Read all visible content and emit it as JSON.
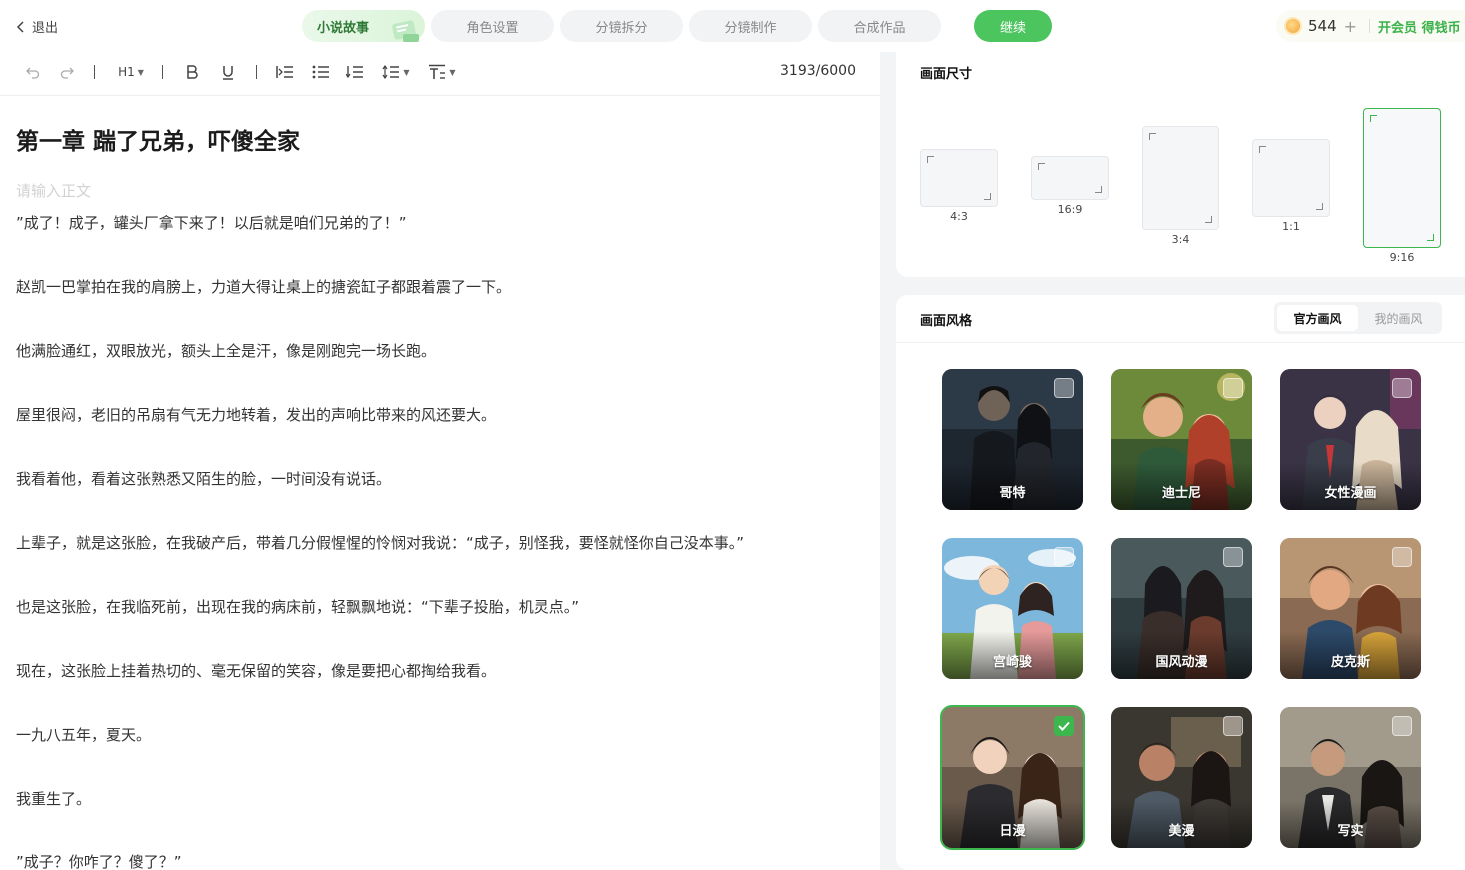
{
  "header": {
    "exit_label": "退出",
    "steps": [
      {
        "label": "小说故事",
        "active": true
      },
      {
        "label": "角色设置",
        "active": false
      },
      {
        "label": "分镜拆分",
        "active": false
      },
      {
        "label": "分镜制作",
        "active": false
      },
      {
        "label": "合成作品",
        "active": false
      }
    ],
    "continue_label": "继续",
    "coins": "544",
    "coin_plus": "+",
    "vip_label": "开会员 得钱币"
  },
  "toolbar": {
    "heading_label": "H1",
    "counter": "3193/6000",
    "icons": [
      "undo-icon",
      "redo-icon",
      "heading-icon",
      "bold-icon",
      "underline-icon",
      "indent-icon",
      "bullet-list-icon",
      "ordered-list-icon",
      "line-height-icon",
      "text-format-icon"
    ]
  },
  "document": {
    "title": "第一章 踹了兄弟，吓傻全家",
    "placeholder": "请输入正文",
    "paragraphs": [
      "”成了！成子，罐头厂拿下来了！以后就是咱们兄弟的了！”",
      "赵凯一巴掌拍在我的肩膀上，力道大得让桌上的搪瓷缸子都跟着震了一下。",
      "他满脸通红，双眼放光，额头上全是汗，像是刚跑完一场长跑。",
      "屋里很闷，老旧的吊扇有气无力地转着，发出的声响比带来的风还要大。",
      "我看着他，看着这张熟悉又陌生的脸，一时间没有说话。",
      "上辈子，就是这张脸，在我破产后，带着几分假惺惺的怜悯对我说：“成子，别怪我，要怪就怪你自己没本事。”",
      "也是这张脸，在我临死前，出现在我的病床前，轻飘飘地说：“下辈子投胎，机灵点。”",
      "现在，这张脸上挂着热切的、毫无保留的笑容，像是要把心都掏给我看。",
      "一九八五年，夏天。",
      "我重生了。",
      "”成子？你咋了？傻了？”"
    ]
  },
  "canvas_size": {
    "title": "画面尺寸",
    "ratios": [
      {
        "label": "4:3",
        "selected": false
      },
      {
        "label": "16:9",
        "selected": false
      },
      {
        "label": "3:4",
        "selected": false
      },
      {
        "label": "1:1",
        "selected": false
      },
      {
        "label": "9:16",
        "selected": true
      }
    ]
  },
  "canvas_style": {
    "title": "画面风格",
    "tabs": [
      {
        "label": "官方画风",
        "active": true
      },
      {
        "label": "我的画风",
        "active": false
      }
    ],
    "styles": [
      {
        "label": "哥特",
        "selected": false
      },
      {
        "label": "迪士尼",
        "selected": false
      },
      {
        "label": "女性漫画",
        "selected": false
      },
      {
        "label": "宫崎骏",
        "selected": false
      },
      {
        "label": "国风动漫",
        "selected": false
      },
      {
        "label": "皮克斯",
        "selected": false
      },
      {
        "label": "日漫",
        "selected": true
      },
      {
        "label": "美漫",
        "selected": false
      },
      {
        "label": "写实",
        "selected": false
      }
    ]
  },
  "colors": {
    "accent_green": "#4cc55f",
    "selected_border": "#3cb64d",
    "vip_text": "#3ab24a"
  }
}
